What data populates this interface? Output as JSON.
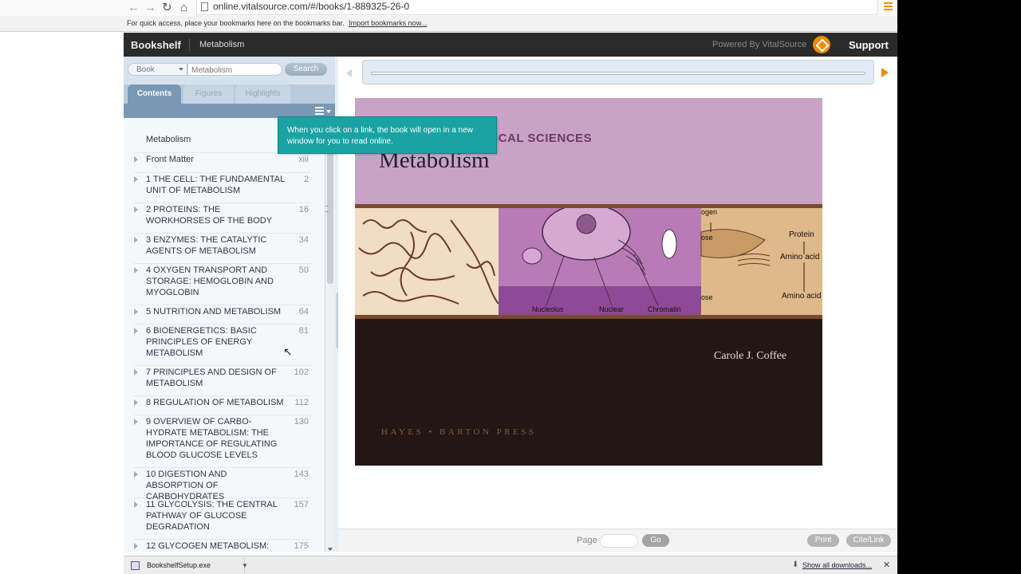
{
  "browser": {
    "url": "online.vitalsource.com/#/books/1-889325-26-0",
    "bookmarks_text": "For quick access, place your bookmarks here on the bookmarks bar.",
    "import_link": "Import bookmarks now..."
  },
  "header": {
    "bookshelf": "Bookshelf",
    "book_title": "Metabolism",
    "powered_by": "Powered By VitalSource",
    "support": "Support"
  },
  "search": {
    "scope": "Book",
    "placeholder": "Metabolism",
    "button": "Search"
  },
  "tabs": {
    "contents": "Contents",
    "figures": "Figures",
    "highlights": "Highlights"
  },
  "toc": [
    {
      "label": "Metabolism",
      "page": ""
    },
    {
      "label": "Front Matter",
      "page": "xiii"
    },
    {
      "label": "1 THE CELL: THE FUNDAMENTAL UNIT OF METABOLISM",
      "page": "2"
    },
    {
      "label": "2 PROTEINS: THE WORKHORSES OF THE BODY",
      "page": "16"
    },
    {
      "label": "3 ENZYMES: THE CATALYTIC AGENTS OF METABOLISM",
      "page": "34"
    },
    {
      "label": "4 OXYGEN TRANSPORT AND STORAGE: HEMOGLOBIN AND MYOGLOBIN",
      "page": "50"
    },
    {
      "label": "5 NUTRITION AND METABOLISM",
      "page": "64"
    },
    {
      "label": "6 BIOENERGETICS: BASIC PRINCIPLES OF ENERGY METABOLISM",
      "page": "81"
    },
    {
      "label": "7 PRINCIPLES AND DESIGN OF METABOLISM",
      "page": "102"
    },
    {
      "label": "8 REGULATION OF METABOLISM",
      "page": "112"
    },
    {
      "label": "9 OVERVIEW OF CARBO-HYDRATE METABOLISM: THE IMPORTANCE OF REGULATING BLOOD GLUCOSE LEVELS",
      "page": "130"
    },
    {
      "label": "10 DIGESTION AND ABSORPTION OF CARBOHYDRATES",
      "page": "143"
    },
    {
      "label": "11 GLYCOLYSIS: THE CENTRAL PATHWAY OF GLUCOSE DEGRADATION",
      "page": "157"
    },
    {
      "label": "12 GLYCOGEN METABOLISM:",
      "page": "175"
    }
  ],
  "tooltip": "When you click on a link, the book will open in a new window for you to read online.",
  "cover": {
    "series": "ICAL SCIENCES",
    "title": "Metabolism",
    "labels": {
      "nucleolus": "Nucleolus",
      "nuclear": "Nuclear",
      "chromatin": "Chromatin",
      "protein": "Protein",
      "amino_acid_1": "Amino acid",
      "amino_acid_2": "Amino acid",
      "ogen": "ogen",
      "ose_1": "ose",
      "ose_2": "ose"
    },
    "author": "Carole J. Coffee",
    "publisher": "HAYES • BARTON PRESS"
  },
  "footer": {
    "page_label": "Page",
    "go": "Go",
    "print": "Print",
    "cite": "Cite/Link"
  },
  "downloads": {
    "file": "BookshelfSetup.exe",
    "show_all": "Show all downloads..."
  },
  "colors": {
    "accent": "#f08a00",
    "tooltip": "#1ba3a3",
    "active_tab": "#7a98b5",
    "sidebar": "#d6e3ef"
  }
}
